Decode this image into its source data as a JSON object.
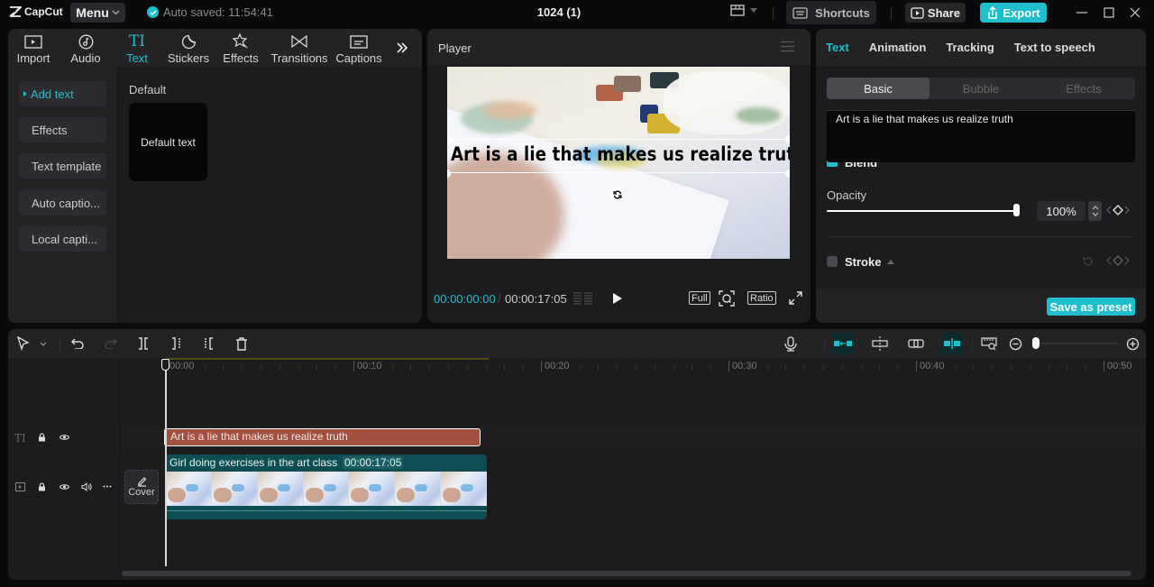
{
  "titlebar": {
    "app_name": "CapCut",
    "menu_label": "Menu",
    "autosave_text": "Auto saved: 11:54:41",
    "project_title": "1024 (1)",
    "shortcuts_label": "Shortcuts",
    "share_label": "Share",
    "export_label": "Export"
  },
  "media_tabs": [
    {
      "label": "Import",
      "icon": "import-icon"
    },
    {
      "label": "Audio",
      "icon": "audio-icon"
    },
    {
      "label": "Text",
      "icon": "text-icon",
      "active": true
    },
    {
      "label": "Stickers",
      "icon": "stickers-icon"
    },
    {
      "label": "Effects",
      "icon": "effects-icon"
    },
    {
      "label": "Transitions",
      "icon": "transitions-icon"
    },
    {
      "label": "Captions",
      "icon": "captions-icon"
    }
  ],
  "text_sidebar": [
    {
      "label": "Add text",
      "active": true
    },
    {
      "label": "Effects"
    },
    {
      "label": "Text template"
    },
    {
      "label": "Auto captio..."
    },
    {
      "label": "Local capti..."
    }
  ],
  "text_library": {
    "section_label": "Default",
    "card_label": "Default text"
  },
  "player": {
    "title": "Player",
    "overlay_text": "Art is a lie that makes us realize truth",
    "time_current": "00:00:00:00",
    "time_separator": "/",
    "time_total": "00:00:17:05",
    "full_label": "Full",
    "ratio_label": "Ratio"
  },
  "properties": {
    "tabs": [
      "Text",
      "Animation",
      "Tracking",
      "Text to speech"
    ],
    "active_tab": "Text",
    "segments": [
      "Basic",
      "Bubble",
      "Effects"
    ],
    "active_segment": "Basic",
    "text_value": "Art is a lie that makes us realize truth",
    "blend_label": "Blend",
    "opacity_label": "Opacity",
    "opacity_value": "100%",
    "opacity_fraction": 1.0,
    "stroke_label": "Stroke",
    "save_preset_label": "Save as preset"
  },
  "timeline": {
    "ruler_labels": [
      "00:00",
      "00:10",
      "00:20",
      "00:30",
      "00:40",
      "00:50"
    ],
    "text_clip_label": "Art is a lie that makes us realize truth",
    "video_clip_title": "Girl doing exercises in the art class",
    "video_clip_duration": "00:00:17:05",
    "cover_label": "Cover"
  },
  "colors": {
    "accent": "#1fbecc",
    "text_clip": "#a4503e",
    "video_clip": "#0e4d52"
  }
}
